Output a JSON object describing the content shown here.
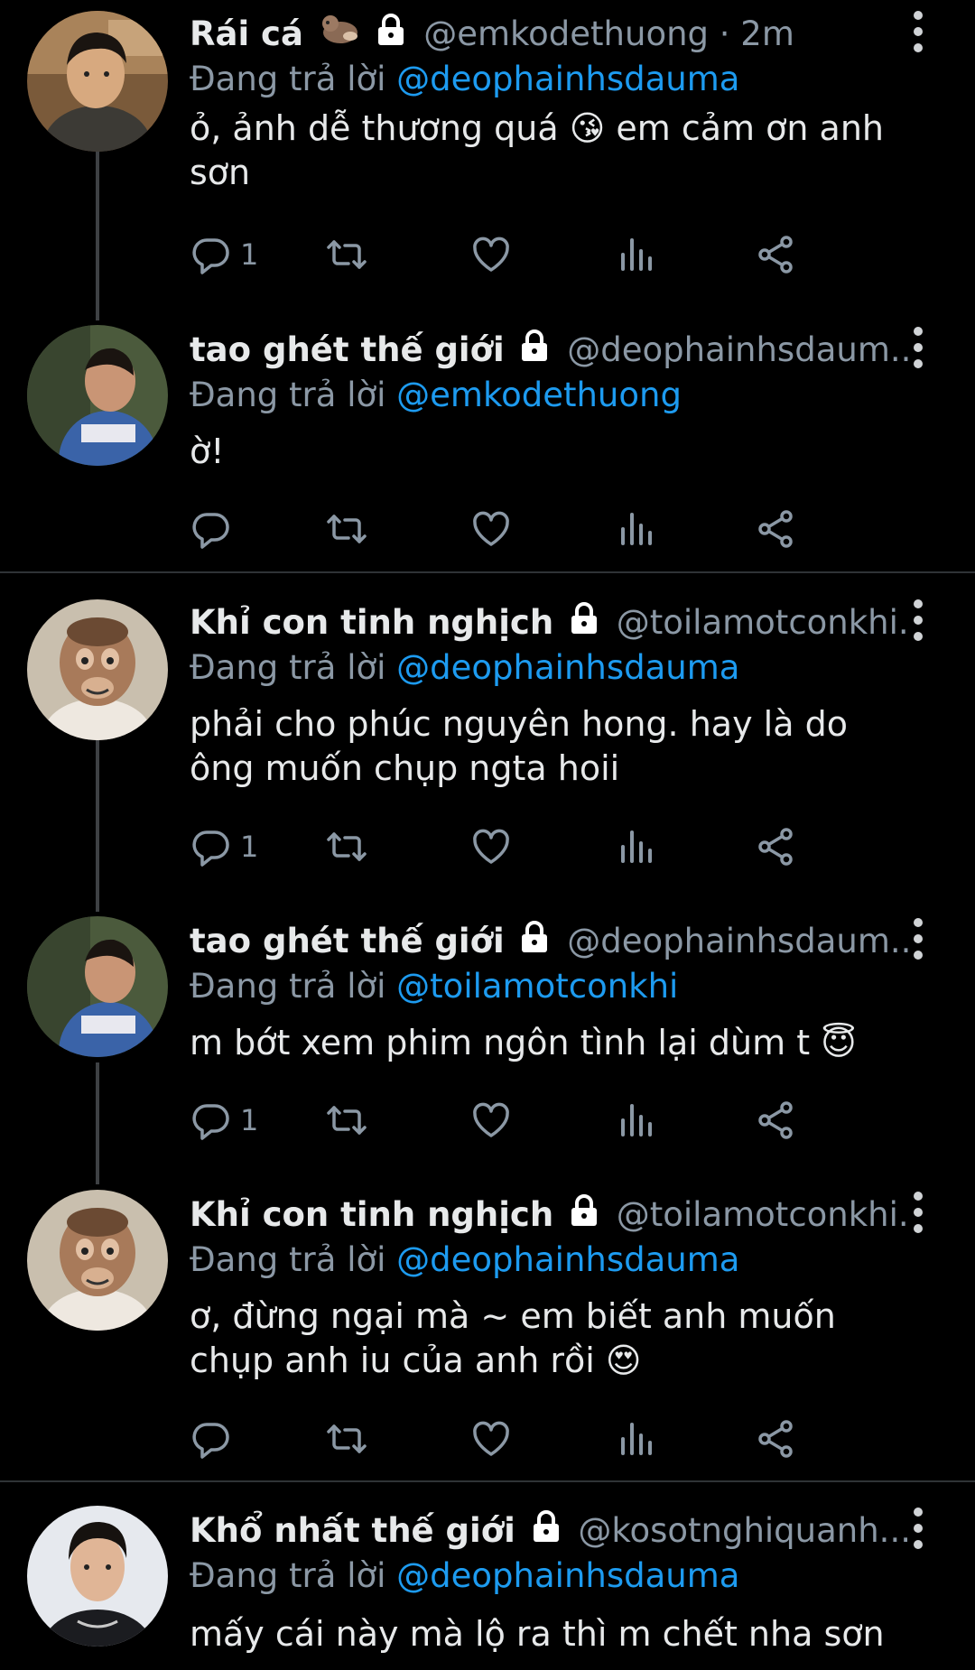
{
  "replying_label": "Đang trả lời",
  "tweets": [
    {
      "name": "Rái cá",
      "handle": "@emkodethuong · 2m",
      "replying_to": "@deophainhsdauma",
      "text": "ỏ, ảnh dễ thương quá 😘 em cảm ơn anh sơn",
      "reply_count": "1",
      "avatar": "boy-avatar"
    },
    {
      "name": "tao ghét thế giới",
      "handle": "@deophainhsdaum...",
      "replying_to": "@emkodethuong",
      "text": "ờ!",
      "reply_count": "",
      "avatar": "child-avatar"
    },
    {
      "name": "Khỉ con tinh nghịch",
      "handle": "@toilamotconkhi...",
      "replying_to": "@deophainhsdauma",
      "text": "phải cho phúc nguyên hong. hay là do ông muốn chụp ngta hoii",
      "reply_count": "1",
      "avatar": "monkey-avatar"
    },
    {
      "name": "tao ghét thế giới",
      "handle": "@deophainhsdaum...",
      "replying_to": "@toilamotconkhi",
      "text": "m bớt xem phim ngôn tình lại dùm t 😇",
      "reply_count": "1",
      "avatar": "child-avatar"
    },
    {
      "name": "Khỉ con tinh nghịch",
      "handle": "@toilamotconkhi...",
      "replying_to": "@deophainhsdauma",
      "text": "ơ, đừng ngại mà ~ em biết anh muốn chụp anh iu của anh rồi 😍",
      "reply_count": "",
      "avatar": "monkey-avatar"
    },
    {
      "name": "Khổ nhất thế giới",
      "handle": "@kosotnghiquanh...",
      "replying_to": "@deophainhsdauma",
      "text": "mấy cái này mà lộ ra thì m chết nha sơn",
      "reply_count": "",
      "avatar": "man-avatar"
    }
  ],
  "colors": {
    "background": "#000000",
    "mention": "#1d9bf0",
    "secondary": "#8b98a5",
    "lock_icon": "lock-icon",
    "otter_icon": "otter-emoji-icon"
  }
}
